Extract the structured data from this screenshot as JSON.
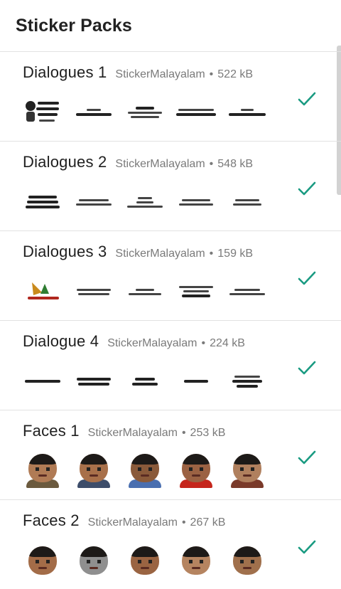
{
  "app": {
    "title": "Sticker Packs"
  },
  "colors": {
    "accent": "#1a9b82",
    "meta_text": "#7a7a7a",
    "divider": "#e2e2e2"
  },
  "packs": [
    {
      "name": "Dialogues 1",
      "publisher": "StickerMalayalam",
      "separator": "•",
      "size": "522 kB",
      "added": true,
      "status_icon": "checkmark-icon"
    },
    {
      "name": "Dialogues 2",
      "publisher": "StickerMalayalam",
      "separator": "•",
      "size": "548 kB",
      "added": true,
      "status_icon": "checkmark-icon"
    },
    {
      "name": "Dialogues 3",
      "publisher": "StickerMalayalam",
      "separator": "•",
      "size": "159 kB",
      "added": true,
      "status_icon": "checkmark-icon"
    },
    {
      "name": "Dialogue 4",
      "publisher": "StickerMalayalam",
      "separator": "•",
      "size": "224 kB",
      "added": true,
      "status_icon": "checkmark-icon"
    },
    {
      "name": "Faces 1",
      "publisher": "StickerMalayalam",
      "separator": "•",
      "size": "253 kB",
      "added": true,
      "status_icon": "checkmark-icon"
    },
    {
      "name": "Faces 2",
      "publisher": "StickerMalayalam",
      "separator": "•",
      "size": "267 kB",
      "added": true,
      "status_icon": "checkmark-icon"
    }
  ]
}
